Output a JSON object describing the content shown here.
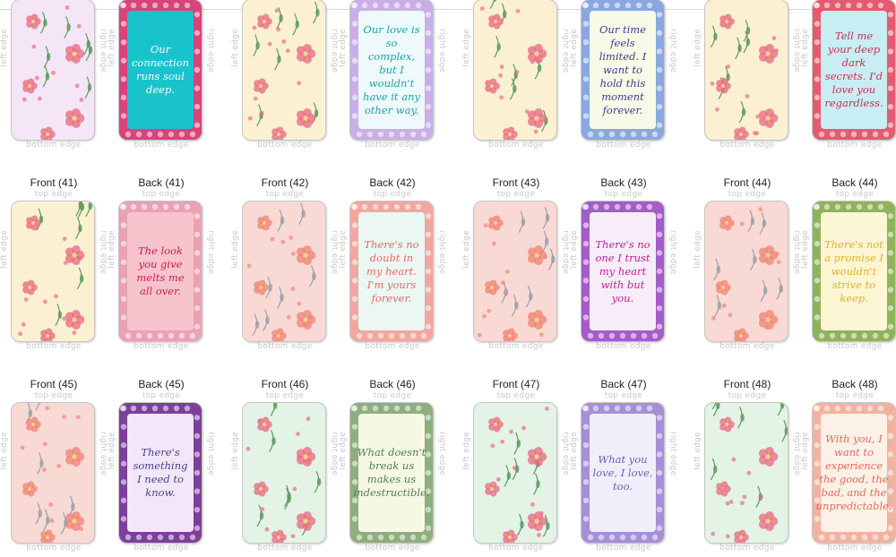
{
  "edges": {
    "top": "top edge",
    "bottom": "bottom edge",
    "left": "left edge",
    "right": "right edge"
  },
  "colors": {
    "rose": "#e86f86",
    "leaf": "#5f9a5e",
    "peach_flower": "#f0867a",
    "grey_leaf": "#9aa0ad"
  },
  "rows": [
    {
      "cells": [
        {
          "label": "",
          "kind": "front",
          "bg": "#f4e6f6",
          "pattern": "floral-pink",
          "frame": "",
          "panel": "",
          "quote": "",
          "text_color": ""
        },
        {
          "label": "",
          "kind": "back",
          "bg": "#d8437a",
          "pattern": "",
          "frame": "#d8437a",
          "panel": "#19c3cc",
          "quote": "Our connection runs soul deep.",
          "text_color": "#ffffff"
        },
        {
          "label": "",
          "kind": "front",
          "bg": "#fbf1d2",
          "pattern": "floral-pink",
          "frame": "",
          "panel": "",
          "quote": "",
          "text_color": ""
        },
        {
          "label": "",
          "kind": "back",
          "bg": "#e6f5f6",
          "pattern": "",
          "frame": "#c9aee8",
          "panel": "#eef9fb",
          "quote": "Our love is so complex, but I wouldn't have it any other way.",
          "text_color": "#1ba5a8"
        },
        {
          "label": "",
          "kind": "front",
          "bg": "#fbf1d2",
          "pattern": "floral-pink",
          "frame": "",
          "panel": "",
          "quote": "",
          "text_color": ""
        },
        {
          "label": "",
          "kind": "back",
          "bg": "#f3f6df",
          "pattern": "",
          "frame": "#8aa8e0",
          "panel": "#f8f9e6",
          "quote": "Our time feels limited. I want to hold this moment forever.",
          "text_color": "#3b3d8f"
        },
        {
          "label": "",
          "kind": "front",
          "bg": "#fbf1d2",
          "pattern": "floral-pink",
          "frame": "",
          "panel": "",
          "quote": "",
          "text_color": ""
        },
        {
          "label": "",
          "kind": "back",
          "bg": "#cdeff4",
          "pattern": "",
          "frame": "#e45b6f",
          "panel": "#c8eef4",
          "quote": "Tell me your deep dark secrets. I'd love you regardless.",
          "text_color": "#c72f4d"
        }
      ]
    },
    {
      "cells": [
        {
          "label": "Front (41)",
          "kind": "front",
          "bg": "#fbf1d2",
          "pattern": "floral-pink",
          "frame": "",
          "panel": "",
          "quote": "",
          "text_color": ""
        },
        {
          "label": "Back (41)",
          "kind": "back",
          "bg": "#f6b6c1",
          "pattern": "",
          "frame": "#e9a1b3",
          "panel": "#f7c3cd",
          "quote": "The look you give melts me all over.",
          "text_color": "#c9204d"
        },
        {
          "label": "Front (42)",
          "kind": "front",
          "bg": "#f9d9d3",
          "pattern": "floral-peach",
          "frame": "",
          "panel": "",
          "quote": "",
          "text_color": ""
        },
        {
          "label": "Back (42)",
          "kind": "back",
          "bg": "#e6f4ef",
          "pattern": "",
          "frame": "#f2a6a0",
          "panel": "#eaf7f2",
          "quote": "There's no doubt in my heart. I'm yours forever.",
          "text_color": "#e56b62"
        },
        {
          "label": "Front (43)",
          "kind": "front",
          "bg": "#f9d9d3",
          "pattern": "floral-peach",
          "frame": "",
          "panel": "",
          "quote": "",
          "text_color": ""
        },
        {
          "label": "Back (43)",
          "kind": "back",
          "bg": "#f4eaf6",
          "pattern": "",
          "frame": "#a45cc8",
          "panel": "#f6edf8",
          "quote": "There's no one I trust my heart with but you.",
          "text_color": "#c01f9c"
        },
        {
          "label": "Front (44)",
          "kind": "front",
          "bg": "#f9d9d3",
          "pattern": "floral-peach",
          "frame": "",
          "panel": "",
          "quote": "",
          "text_color": ""
        },
        {
          "label": "Back (44)",
          "kind": "back",
          "bg": "#fbf5cf",
          "pattern": "",
          "frame": "#8fb35a",
          "panel": "#fcf6d4",
          "quote": "There's not a promise I wouldn't strive to keep.",
          "text_color": "#e6b21e"
        }
      ]
    },
    {
      "cells": [
        {
          "label": "Front (45)",
          "kind": "front",
          "bg": "#f9d9d3",
          "pattern": "floral-peach",
          "frame": "",
          "panel": "",
          "quote": "",
          "text_color": ""
        },
        {
          "label": "Back (45)",
          "kind": "back",
          "bg": "#efe3f6",
          "pattern": "",
          "frame": "#7c3f9a",
          "panel": "#f2e7f8",
          "quote": "There's something I need to know.",
          "text_color": "#4b3f8f"
        },
        {
          "label": "Front (46)",
          "kind": "front",
          "bg": "#e3f3e6",
          "pattern": "floral-pink",
          "frame": "",
          "panel": "",
          "quote": "",
          "text_color": ""
        },
        {
          "label": "Back (46)",
          "kind": "back",
          "bg": "#f3f6df",
          "pattern": "",
          "frame": "#8fae7e",
          "panel": "#f6f8e6",
          "quote": "What doesn't break us makes us indestructible.",
          "text_color": "#4f7d5a"
        },
        {
          "label": "Front (47)",
          "kind": "front",
          "bg": "#e3f3e6",
          "pattern": "floral-pink",
          "frame": "",
          "panel": "",
          "quote": "",
          "text_color": ""
        },
        {
          "label": "Back (47)",
          "kind": "back",
          "bg": "#eceaf8",
          "pattern": "",
          "frame": "#a58fd6",
          "panel": "#f0eefb",
          "quote": "What you love, I love, too.",
          "text_color": "#6a5fb8"
        },
        {
          "label": "Front (48)",
          "kind": "front",
          "bg": "#e3f3e6",
          "pattern": "floral-pink",
          "frame": "",
          "panel": "",
          "quote": "",
          "text_color": ""
        },
        {
          "label": "Back (48)",
          "kind": "back",
          "bg": "#fbefe4",
          "pattern": "",
          "frame": "#f1b3a0",
          "panel": "#fcf1e7",
          "quote": "With you, I want to experience the good, the bad, and the unpredictable.",
          "text_color": "#e06a5a"
        }
      ]
    }
  ]
}
